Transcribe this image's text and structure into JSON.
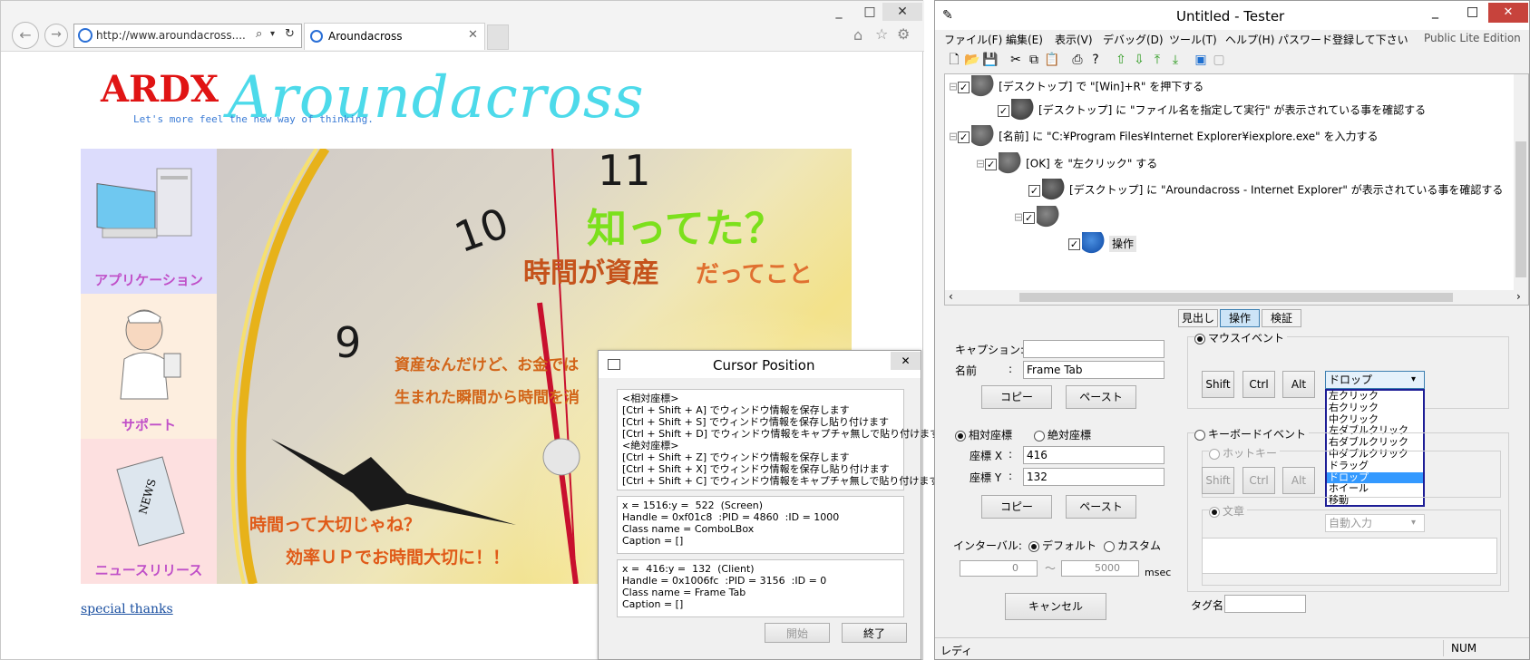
{
  "browser": {
    "address": "http://www.aroundacross....",
    "tab_title": "Aroundacross",
    "window_controls": [
      "_",
      "□",
      "✕"
    ],
    "site": {
      "logo_ardx": "ARDX",
      "logo_script": "Aroundacross",
      "tagline": "Let's more feel the new way of thinking.",
      "side": [
        {
          "label": "アプリケーション"
        },
        {
          "label": "サポート"
        },
        {
          "label": "ニュースリリース"
        }
      ],
      "hero_line1": "知ってた？",
      "hero_line2a": "時間が資産",
      "hero_line2b": "だってこと",
      "hero_line3": "資産なんだけど、お金では",
      "hero_line4": "生まれた瞬間から時間を消",
      "hero_line5": "時間って大切じゃね？",
      "hero_line6": "効率ＵＰでお時間大切に！！",
      "special_thanks": "special thanks"
    }
  },
  "cursor_dialog": {
    "title": "Cursor Position",
    "close": "✕",
    "group1": "<相対座標>\n[Ctrl + Shift + A] でウィンドウ情報を保存します\n[Ctrl + Shift + S] でウィンドウ情報を保存し貼り付けます\n[Ctrl + Shift + D] でウィンドウ情報をキャプチャ無しで貼り付けます\n<絶対座標>\n[Ctrl + Shift + Z] でウィンドウ情報を保存します\n[Ctrl + Shift + X] でウィンドウ情報を保存し貼り付けます\n[Ctrl + Shift + C] でウィンドウ情報をキャプチャ無しで貼り付けます",
    "group2": "x = 1516:y =  522  (Screen)\nHandle = 0xf01c8  :PID = 4860  :ID = 1000\nClass name = ComboLBox\nCaption = []",
    "group3": "x =  416:y =  132  (Client)\nHandle = 0x1006fc  :PID = 3156  :ID = 0\nClass name = Frame Tab\nCaption = []",
    "start": "開始",
    "end": "終了"
  },
  "tester": {
    "title": "Untitled - Tester",
    "window_controls": [
      "_",
      "□",
      "✕"
    ],
    "menu": [
      "ファイル(F)",
      "編集(E)",
      "表示(V)",
      "デバッグ(D)",
      "ツール(T)",
      "ヘルプ(H)",
      "パスワード登録して下さい"
    ],
    "edition": "Public Lite Edition",
    "tree": [
      {
        "text": "[デスクトップ] で \"[Win]+R\" を押下する"
      },
      {
        "text": "[デスクトップ] に \"ファイル名を指定して実行\" が表示されている事を確認する"
      },
      {
        "text": "[名前] に \"C:¥Program Files¥Internet Explorer¥iexplore.exe\" を入力する"
      },
      {
        "text": "[OK] を \"左クリック\" する"
      },
      {
        "text": "[デスクトップ] に \"Aroundacross - Internet Explorer\" が表示されている事を確認する"
      },
      {
        "text": ""
      },
      {
        "text": "操作"
      }
    ],
    "form": {
      "caption_label": "キャプション:",
      "caption_value": "",
      "name_label": "名前",
      "name_colon": ":",
      "name_value": "Frame Tab",
      "copy": "コピー",
      "paste": "ペースト",
      "relative": "相対座標",
      "absolute": "絶対座標",
      "x_label": "座標 X",
      "x_value": "416",
      "y_label": "座標 Y",
      "y_value": "132",
      "interval_label": "インターバル:",
      "default": "デフォルト",
      "custom": "カスタム",
      "interval_from": "0",
      "interval_to": "5000",
      "tilde": "～",
      "msec": "msec",
      "cancel": "キャンセル",
      "tabs": [
        "見出し",
        "操作",
        "検証"
      ],
      "mouse_event": "マウスイベント",
      "shift": "Shift",
      "ctrl": "Ctrl",
      "alt": "Alt",
      "mouse_selected": "ドロップ",
      "mouse_options": [
        "左クリック",
        "右クリック",
        "中クリック",
        "左ダブルクリック",
        "右ダブルクリック",
        "中ダブルクリック",
        "ドラッグ",
        "ドロップ",
        "ホイール",
        "移動"
      ],
      "keyboard_event": "キーボードイベント",
      "hotkey": "ホットキー",
      "text_label": "文章",
      "auto_input": "自動入力",
      "tag_label": "タグ名",
      "tag_value": ""
    },
    "status_left": "レディ",
    "status_num": "NUM"
  }
}
